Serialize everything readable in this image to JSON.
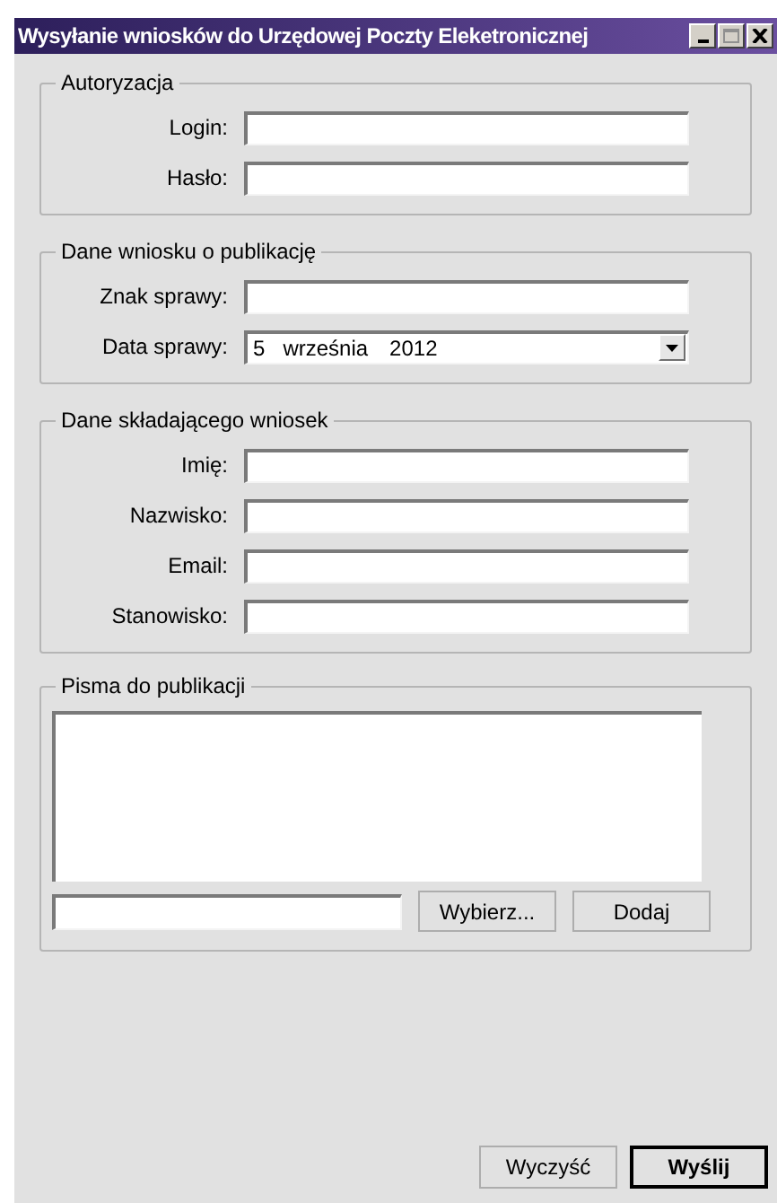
{
  "window": {
    "title": "Wysyłanie wniosków do Urzędowej Poczty Eleketronicznej"
  },
  "groups": [
    {
      "kind": "form",
      "title": "Autoryzacja",
      "fields": [
        {
          "kind": "text",
          "label": "Login:"
        },
        {
          "kind": "text",
          "label": "Hasło:"
        }
      ]
    },
    {
      "kind": "form",
      "title": "Dane wniosku o publikację",
      "fields": [
        {
          "kind": "text",
          "label": "Znak sprawy:"
        },
        {
          "kind": "date",
          "label": "Data sprawy:",
          "day": "5",
          "month": "września",
          "year": "2012"
        }
      ]
    },
    {
      "kind": "form",
      "title": "Dane składającego wniosek",
      "fields": [
        {
          "kind": "text",
          "label": "Imię:"
        },
        {
          "kind": "text",
          "label": "Nazwisko:"
        },
        {
          "kind": "text",
          "label": "Email:"
        },
        {
          "kind": "text",
          "label": "Stanowisko:"
        }
      ]
    },
    {
      "kind": "files",
      "title": "Pisma do publikacji",
      "buttons": [
        "Wybierz...",
        "Dodaj"
      ]
    }
  ],
  "footer_buttons": [
    {
      "label": "Wyczyść",
      "default": false
    },
    {
      "label": "Wyślij",
      "default": true
    }
  ]
}
